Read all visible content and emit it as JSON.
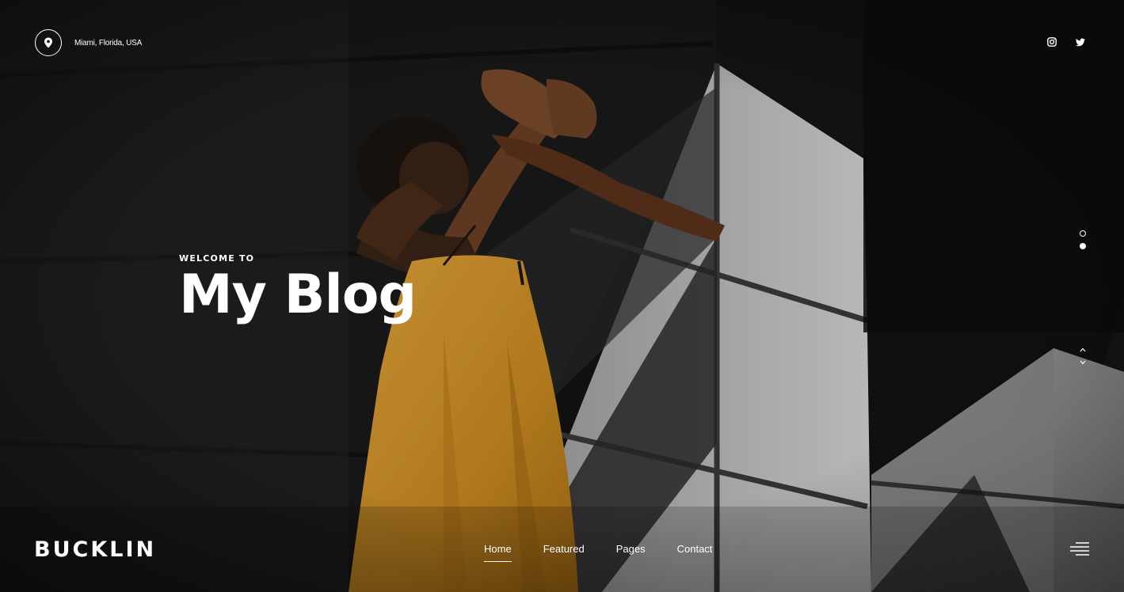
{
  "header": {
    "location": "Miami, Florida, USA",
    "location_icon": "map-pin-icon",
    "social": [
      {
        "name": "instagram",
        "icon": "instagram-icon"
      },
      {
        "name": "twitter",
        "icon": "twitter-icon"
      }
    ]
  },
  "hero": {
    "eyebrow": "WELCOME TO",
    "title": "My Blog",
    "slides_total": 2,
    "active_slide": 2
  },
  "footer_bar": {
    "brand": "BUCKLIN",
    "nav": [
      {
        "label": "Home",
        "active": true
      },
      {
        "label": "Featured",
        "active": false
      },
      {
        "label": "Pages",
        "active": false
      },
      {
        "label": "Contact",
        "active": false
      }
    ],
    "menu_icon": "hamburger-menu-icon"
  },
  "colors": {
    "text": "#ffffff",
    "dress": "#d99a2e",
    "background": "#0d0d0d"
  }
}
